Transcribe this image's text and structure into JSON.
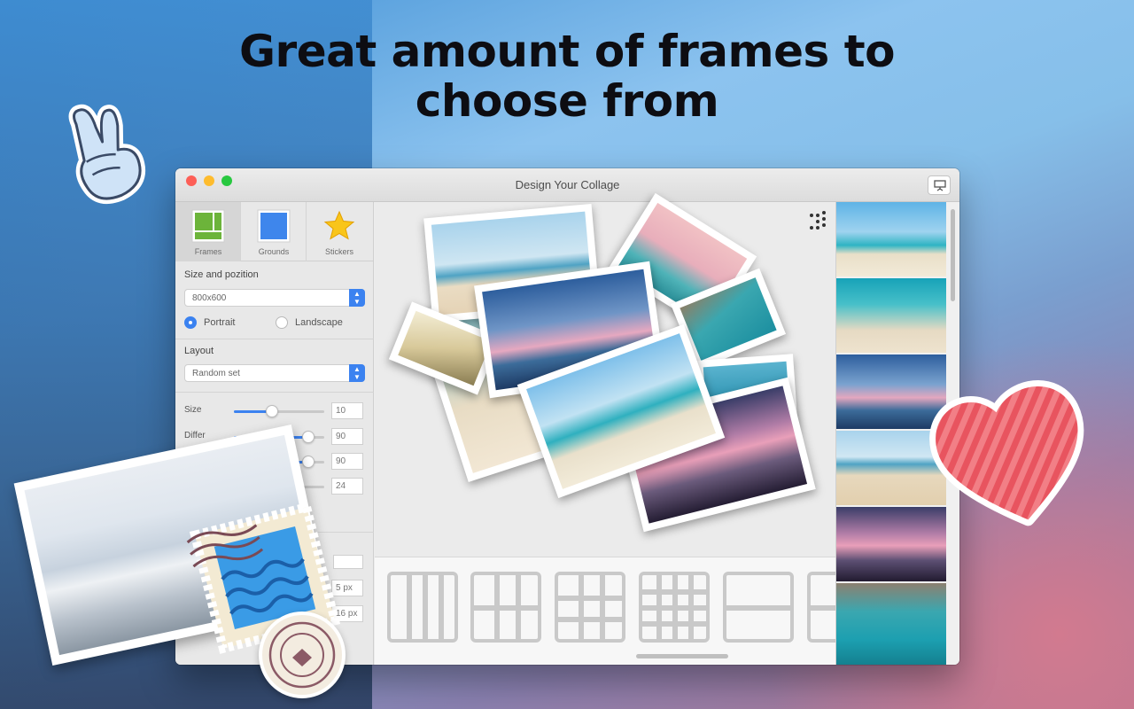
{
  "headline": {
    "line1": "Great amount of frames to",
    "line2": "choose from"
  },
  "window": {
    "title": "Design Your Collage",
    "present_icon": "presentation-icon"
  },
  "tabs": [
    {
      "label": "Frames",
      "icon": "frames-icon",
      "active": true
    },
    {
      "label": "Grounds",
      "icon": "grounds-icon",
      "active": false
    },
    {
      "label": "Stickers",
      "icon": "star-icon",
      "active": false
    }
  ],
  "size_section": {
    "title": "Size and pozition",
    "size_value": "800x600",
    "portrait_label": "Portrait",
    "landscape_label": "Landscape",
    "orientation": "Portrait"
  },
  "layout_section": {
    "title": "Layout",
    "value": "Random set"
  },
  "sliders": [
    {
      "label": "Size",
      "value": "10",
      "level": 0.42
    },
    {
      "label": "Differ",
      "value": "90",
      "level": 0.82
    },
    {
      "label": "",
      "value": "90",
      "level": 0.82
    },
    {
      "label": "",
      "value": "24",
      "level": 0.3
    }
  ],
  "bottom_fields": {
    "field1": "5 px",
    "field2": "16 px"
  },
  "layouts_strip": [
    "4-columns",
    "3x2-grid",
    "3x3-grid",
    "4x4-grid",
    "2-rows",
    "partial"
  ],
  "colors": {
    "accent": "#3b82f0",
    "title_text": "#0d0d12"
  }
}
